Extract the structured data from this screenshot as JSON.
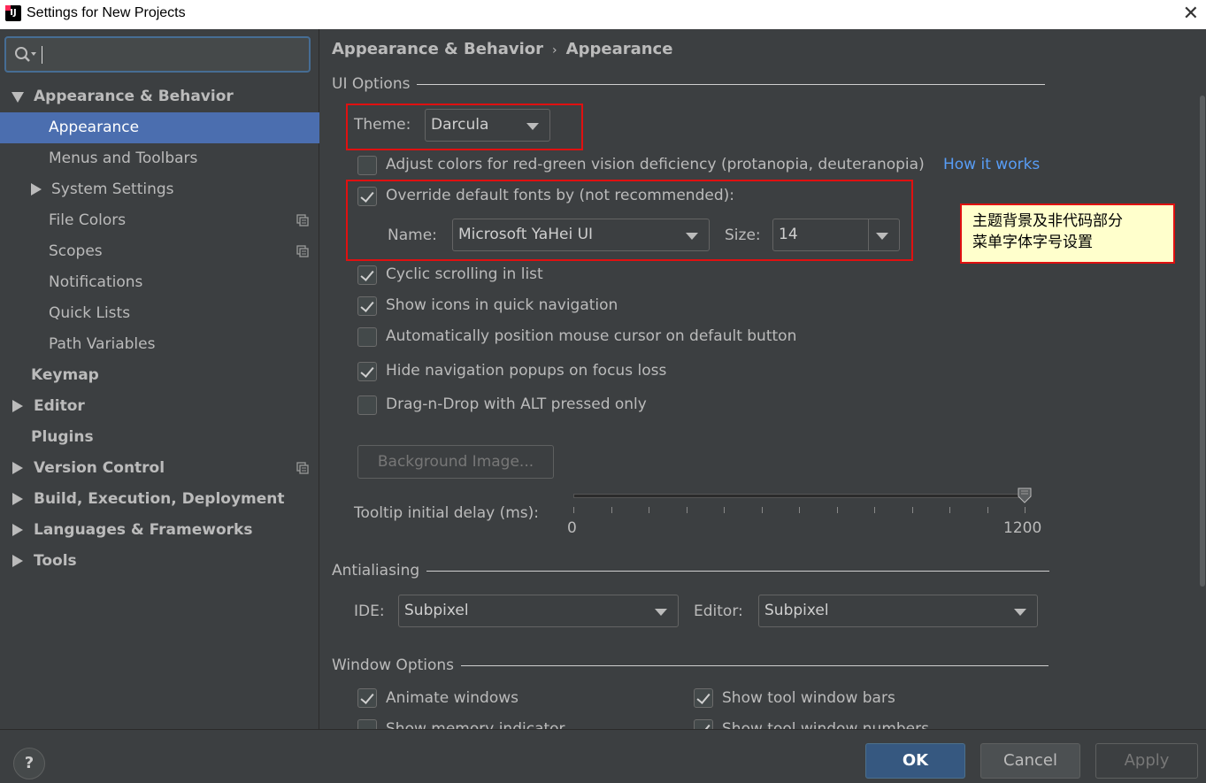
{
  "window": {
    "title": "Settings for New Projects",
    "app_icon_label": "IJ"
  },
  "sidebar": {
    "items": [
      {
        "label": "Appearance & Behavior",
        "level": 0,
        "expanded": true,
        "bold": true
      },
      {
        "label": "Appearance",
        "level": 1,
        "selected": true
      },
      {
        "label": "Menus and Toolbars",
        "level": 1
      },
      {
        "label": "System Settings",
        "level": 1,
        "collapsed": true
      },
      {
        "label": "File Colors",
        "level": 1,
        "copy_icon": true
      },
      {
        "label": "Scopes",
        "level": 1,
        "copy_icon": true
      },
      {
        "label": "Notifications",
        "level": 1
      },
      {
        "label": "Quick Lists",
        "level": 1
      },
      {
        "label": "Path Variables",
        "level": 1
      },
      {
        "label": "Keymap",
        "level": 0,
        "bold": true
      },
      {
        "label": "Editor",
        "level": 0,
        "collapsed": true,
        "bold": true
      },
      {
        "label": "Plugins",
        "level": 0,
        "bold": true
      },
      {
        "label": "Version Control",
        "level": 0,
        "collapsed": true,
        "bold": true,
        "copy_icon": true
      },
      {
        "label": "Build, Execution, Deployment",
        "level": 0,
        "collapsed": true,
        "bold": true
      },
      {
        "label": "Languages & Frameworks",
        "level": 0,
        "collapsed": true,
        "bold": true
      },
      {
        "label": "Tools",
        "level": 0,
        "collapsed": true,
        "bold": true
      }
    ]
  },
  "breadcrumb": {
    "parent": "Appearance & Behavior",
    "separator": "›",
    "current": "Appearance"
  },
  "ui_options": {
    "title": "UI Options",
    "theme_label": "Theme:",
    "theme_value": "Darcula",
    "adjust_colors": "Adjust colors for red-green vision deficiency (protanopia, deuteranopia)",
    "how_it_works": "How it works",
    "override_fonts": "Override default fonts by (not recommended):",
    "name_label": "Name:",
    "name_value": "Microsoft YaHei UI",
    "size_label": "Size:",
    "size_value": "14",
    "cyclic_scrolling": "Cyclic scrolling in list",
    "show_icons": "Show icons in quick navigation",
    "auto_position": "Automatically position mouse cursor on default button",
    "hide_popups": "Hide navigation popups on focus loss",
    "drag_drop": "Drag-n-Drop with ALT pressed only",
    "background_image": "Background Image...",
    "tooltip_label": "Tooltip initial delay (ms):",
    "tooltip_min": "0",
    "tooltip_max": "1200",
    "tooltip_value_fraction": 1.0
  },
  "callout": {
    "line1": "主题背景及非代码部分",
    "line2": "菜单字体字号设置"
  },
  "antialiasing": {
    "title": "Antialiasing",
    "ide_label": "IDE:",
    "ide_value": "Subpixel",
    "editor_label": "Editor:",
    "editor_value": "Subpixel"
  },
  "window_options": {
    "title": "Window Options",
    "animate_windows": "Animate windows",
    "show_tool_window_bars": "Show tool window bars",
    "show_memory_indicator": "Show memory indicator",
    "show_tool_window_numbers": "Show tool window numbers"
  },
  "footer": {
    "help": "?",
    "ok": "OK",
    "cancel": "Cancel",
    "apply": "Apply"
  },
  "colors": {
    "selection": "#4b6eaf",
    "link": "#589df6",
    "highlight_box": "#e01010",
    "callout_bg": "#ffffcc",
    "ok_button": "#365880"
  }
}
